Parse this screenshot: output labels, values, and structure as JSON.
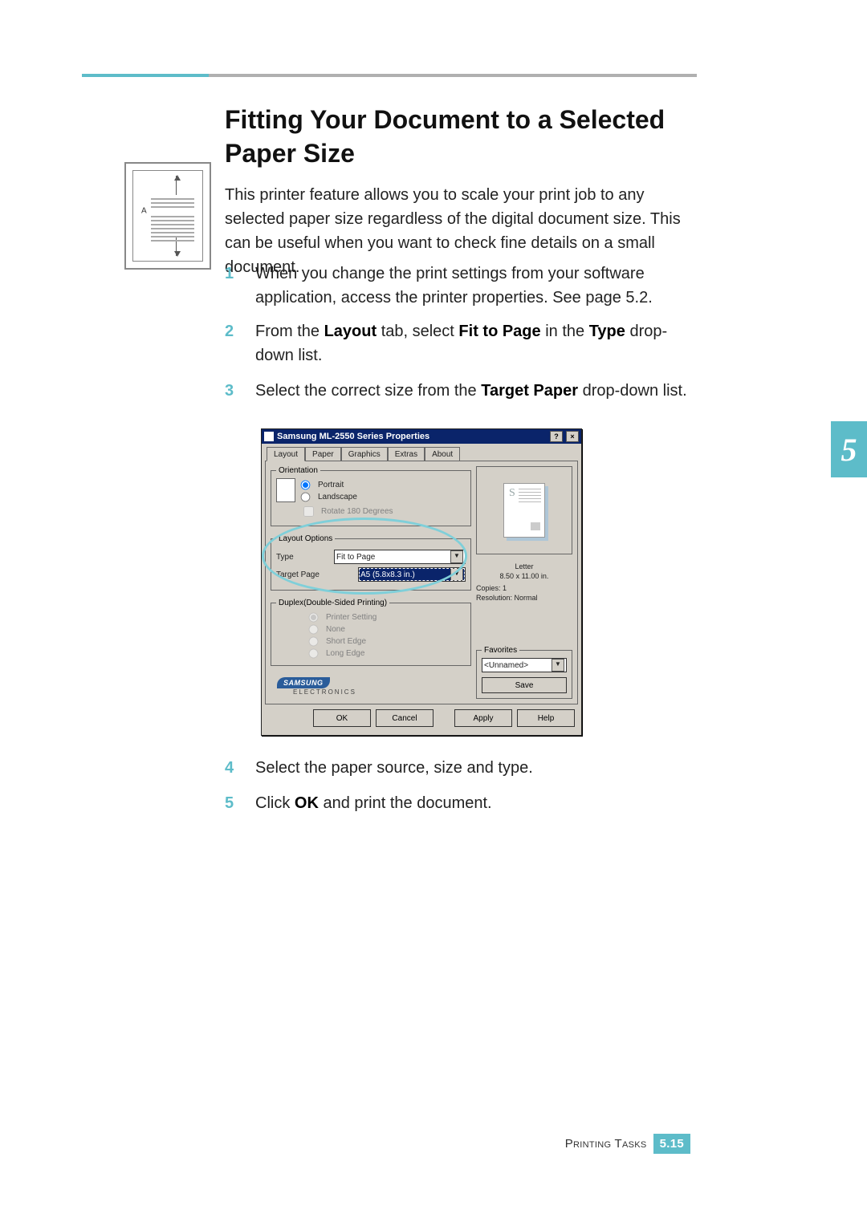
{
  "page": {
    "title": "Fitting Your Document to a Selected Paper Size",
    "intro": "This printer feature allows you to scale your print job to any selected paper size regardless of the digital document size. This can be useful when you want to check fine details on a small document.",
    "figure_label": "A",
    "side_tab": "5",
    "steps": {
      "n1": "1",
      "t1": "When you change the print settings from your software application, access the printer properties. See page 5.2.",
      "n2": "2",
      "t2a": "From the ",
      "t2b": "Layout",
      "t2c": " tab, select ",
      "t2d": "Fit to Page",
      "t2e": " in the ",
      "t2f": "Type",
      "t2g": " drop-down list.",
      "n3": "3",
      "t3a": "Select the correct size from the ",
      "t3b": "Target Paper",
      "t3c": " drop-down list.",
      "n4": "4",
      "t4": "Select the paper source, size and type.",
      "n5": "5",
      "t5a": "Click ",
      "t5b": "OK",
      "t5c": " and print the document."
    },
    "footer": {
      "section": "Printing Tasks",
      "chapter": "5.",
      "pagenum": "15"
    }
  },
  "dialog": {
    "title": "Samsung ML-2550 Series Properties",
    "titlebar_help": "?",
    "titlebar_close": "×",
    "tabs": [
      "Layout",
      "Paper",
      "Graphics",
      "Extras",
      "About"
    ],
    "orientation": {
      "legend": "Orientation",
      "portrait": "Portrait",
      "landscape": "Landscape",
      "rotate": "Rotate 180 Degrees"
    },
    "layout_options": {
      "legend": "Layout Options",
      "type_label": "Type",
      "type_value": "Fit to Page",
      "target_label": "Target Page",
      "target_value": "A5 (5.8x8.3 in.)"
    },
    "duplex": {
      "legend": "Duplex(Double-Sided Printing)",
      "opt1": "Printer Setting",
      "opt2": "None",
      "opt3": "Short Edge",
      "opt4": "Long Edge"
    },
    "preview": {
      "paper_name": "Letter",
      "paper_dim": "8.50 x 11.00 in.",
      "copies": "Copies: 1",
      "resolution": "Resolution: Normal"
    },
    "favorites": {
      "legend": "Favorites",
      "value": "<Unnamed>",
      "save": "Save"
    },
    "logo": {
      "brand": "SAMSUNG",
      "sub": "ELECTRONICS"
    },
    "buttons": {
      "ok": "OK",
      "cancel": "Cancel",
      "apply": "Apply",
      "help": "Help"
    }
  }
}
